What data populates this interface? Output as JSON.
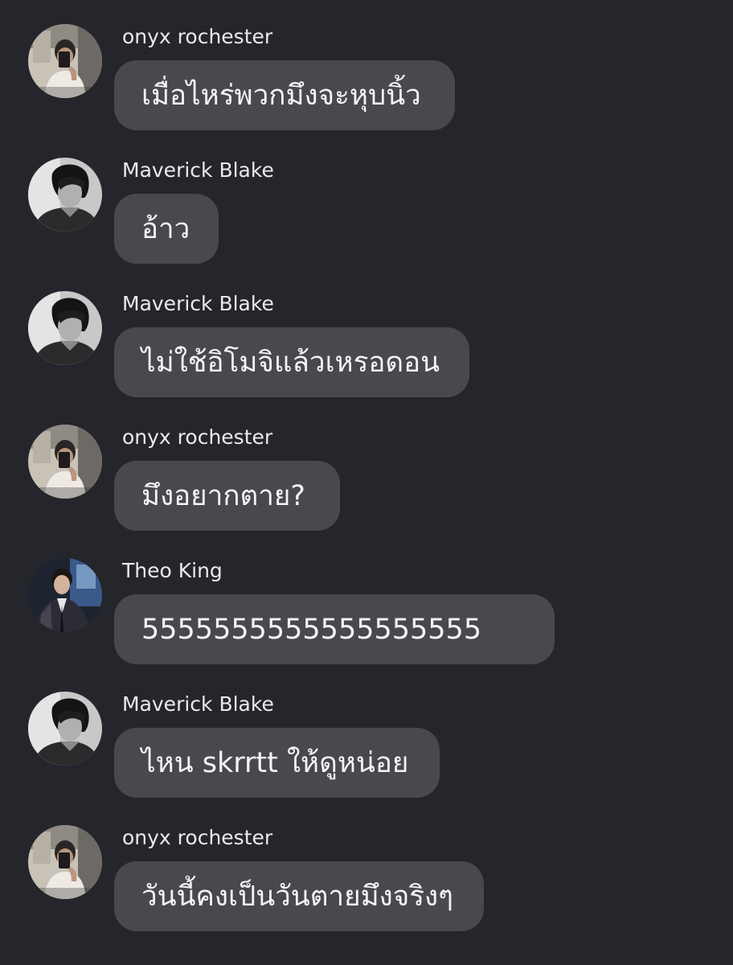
{
  "messages": [
    {
      "sender": "onyx rochester",
      "avatar": "onyx-avatar",
      "text": "เมื่อไหร่พวกมึงจะหุบนิ้ว"
    },
    {
      "sender": "Maverick Blake",
      "avatar": "maverick-avatar",
      "text": "อ้าว"
    },
    {
      "sender": "Maverick Blake",
      "avatar": "maverick-avatar",
      "text": "ไม่ใช้อิโมจิแล้วเหรอดอน"
    },
    {
      "sender": "onyx rochester",
      "avatar": "onyx-avatar",
      "text": "มึงอยากตาย?"
    },
    {
      "sender": "Theo King",
      "avatar": "theo-avatar",
      "text": "5555555555555555555"
    },
    {
      "sender": "Maverick Blake",
      "avatar": "maverick-avatar",
      "text": "ไหน skrrtt ให้ดูหน่อย"
    },
    {
      "sender": "onyx rochester",
      "avatar": "onyx-avatar",
      "text": "วันนี้คงเป็นวันตายมึงจริงๆ"
    }
  ],
  "colors": {
    "background": "#25252c",
    "bubble": "#48484f",
    "text": "#f4f4f6"
  }
}
